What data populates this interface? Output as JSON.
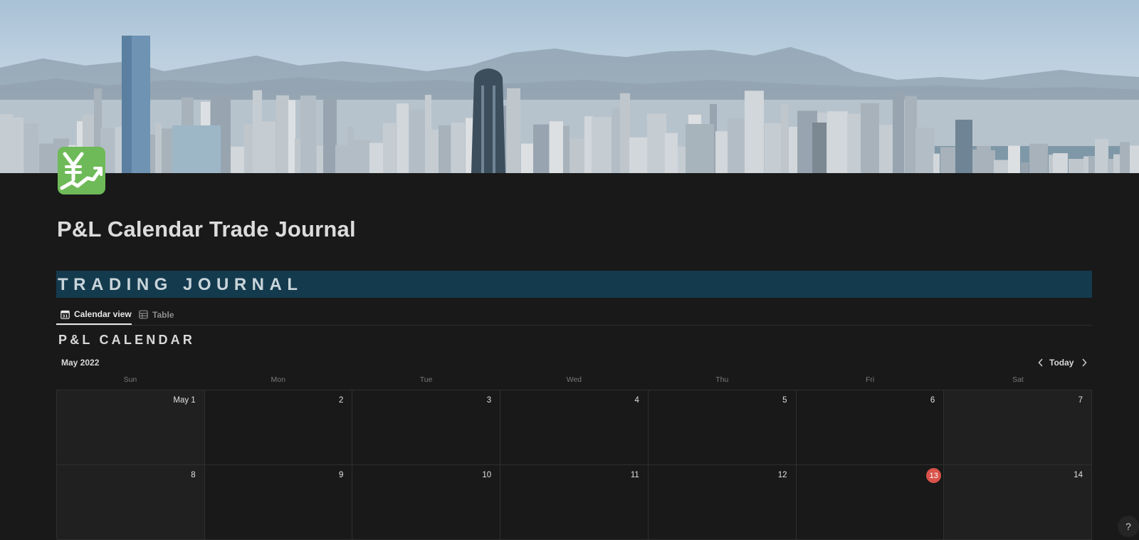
{
  "page": {
    "title": "P&L Calendar Trade Journal",
    "icon": "yen-chart-icon"
  },
  "banner": {
    "text": "TRADING JOURNAL"
  },
  "views": {
    "tabs": [
      {
        "label": "Calendar view",
        "icon": "calendar-icon",
        "active": true
      },
      {
        "label": "Table",
        "icon": "table-icon",
        "active": false
      }
    ]
  },
  "calendar": {
    "heading": "P&L CALENDAR",
    "month": "May 2022",
    "today_label": "Today",
    "weekdays": [
      "Sun",
      "Mon",
      "Tue",
      "Wed",
      "Thu",
      "Fri",
      "Sat"
    ],
    "days": [
      "May 1",
      "2",
      "3",
      "4",
      "5",
      "6",
      "7",
      "8",
      "9",
      "10",
      "11",
      "12",
      "13",
      "14"
    ],
    "today": "13",
    "today_color": "#d9534a"
  },
  "help": {
    "label": "?"
  },
  "colors": {
    "background": "#191919",
    "banner": "#143a4e",
    "icon_bg": "#6fba58"
  }
}
